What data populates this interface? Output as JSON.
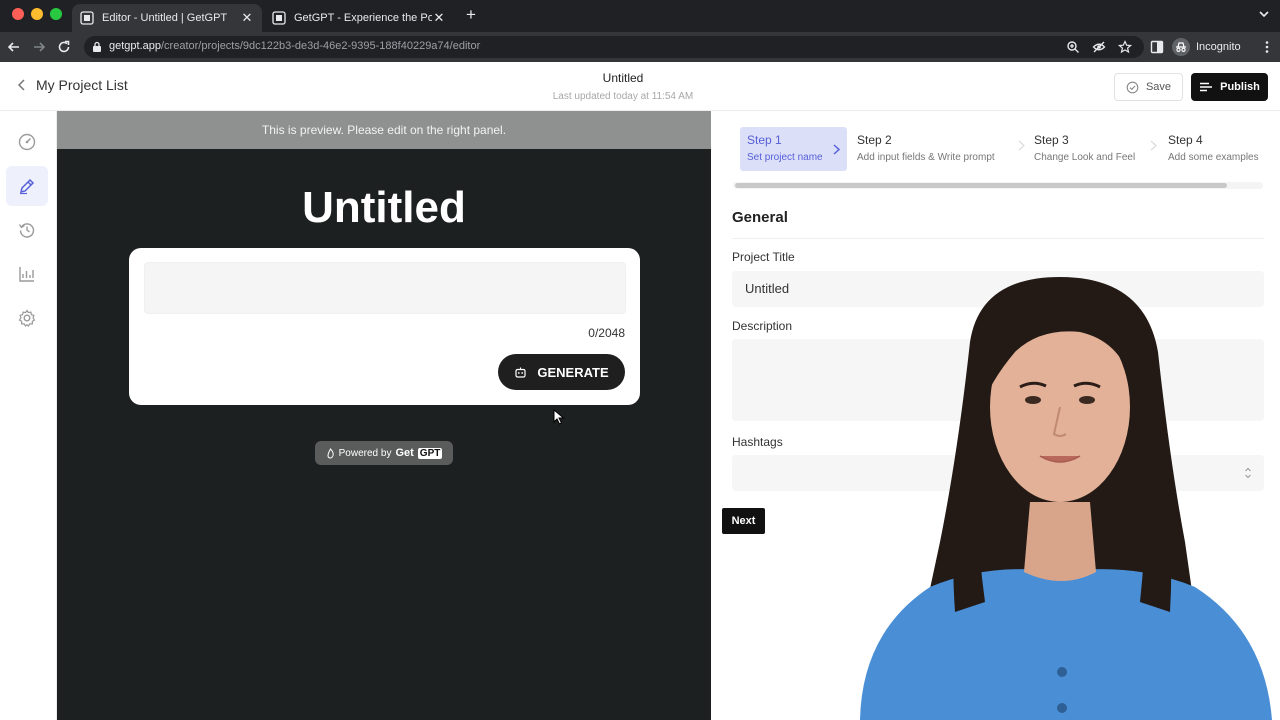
{
  "browser": {
    "tabs": [
      {
        "title": "Editor - Untitled | GetGPT",
        "active": true
      },
      {
        "title": "GetGPT - Experience the Pow",
        "active": false
      }
    ],
    "url_host": "getgpt.app",
    "url_path": "/creator/projects/9dc122b3-de3d-46e2-9395-188f40229a74/editor",
    "profile_label": "Incognito"
  },
  "header": {
    "back_label": "My Project List",
    "title": "Untitled",
    "subtitle": "Last updated today at 11:54 AM",
    "save_label": "Save",
    "publish_label": "Publish"
  },
  "sidebar": {
    "items": [
      {
        "icon": "gauge-icon",
        "active": false
      },
      {
        "icon": "pencil-icon",
        "active": true
      },
      {
        "icon": "history-icon",
        "active": false
      },
      {
        "icon": "analytics-icon",
        "active": false
      },
      {
        "icon": "gear-icon",
        "active": false
      }
    ]
  },
  "preview": {
    "banner": "This is preview. Please edit on the right panel.",
    "title": "Untitled",
    "char_count": "0/2048",
    "generate_label": "GENERATE",
    "powered_prefix": "Powered by",
    "powered_brand_get": "Get",
    "powered_brand_gpt": "GPT"
  },
  "editor": {
    "steps": [
      {
        "label": "Step 1",
        "desc": "Set project name",
        "active": true
      },
      {
        "label": "Step 2",
        "desc": "Add input fields & Write prompt",
        "active": false
      },
      {
        "label": "Step 3",
        "desc": "Change Look and Feel",
        "active": false
      },
      {
        "label": "Step 4",
        "desc": "Add some examples",
        "active": false
      }
    ],
    "section_title": "General",
    "project_title_label": "Project Title",
    "project_title_value": "Untitled",
    "description_label": "Description",
    "hashtags_label": "Hashtags",
    "next_label": "Next"
  },
  "colors": {
    "accent": "#5660d8",
    "accent_bg": "#dcdff8",
    "preview_bg": "#1d2021",
    "primary_button": "#111111"
  }
}
